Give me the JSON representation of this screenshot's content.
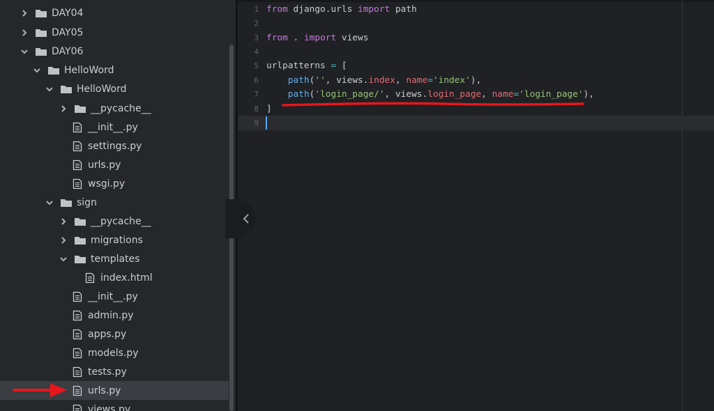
{
  "sidebar": {
    "items": [
      {
        "label": "DAY04",
        "kind": "folder",
        "chevron": "right"
      },
      {
        "label": "DAY05",
        "kind": "folder",
        "chevron": "right"
      },
      {
        "label": "DAY06",
        "kind": "folder",
        "chevron": "down"
      },
      {
        "label": "HelloWord",
        "kind": "folder",
        "chevron": "down"
      },
      {
        "label": "HelloWord",
        "kind": "folder",
        "chevron": "down"
      },
      {
        "label": "__pycache__",
        "kind": "folder",
        "chevron": "right"
      },
      {
        "label": "__init__.py",
        "kind": "file"
      },
      {
        "label": "settings.py",
        "kind": "file"
      },
      {
        "label": "urls.py",
        "kind": "file"
      },
      {
        "label": "wsgi.py",
        "kind": "file"
      },
      {
        "label": "sign",
        "kind": "folder",
        "chevron": "down"
      },
      {
        "label": "__pycache__",
        "kind": "folder",
        "chevron": "right"
      },
      {
        "label": "migrations",
        "kind": "folder",
        "chevron": "right"
      },
      {
        "label": "templates",
        "kind": "folder",
        "chevron": "down"
      },
      {
        "label": "index.html",
        "kind": "file"
      },
      {
        "label": "__init__.py",
        "kind": "file"
      },
      {
        "label": "admin.py",
        "kind": "file"
      },
      {
        "label": "apps.py",
        "kind": "file"
      },
      {
        "label": "models.py",
        "kind": "file"
      },
      {
        "label": "tests.py",
        "kind": "file"
      },
      {
        "label": "urls.py",
        "kind": "file",
        "selected": true
      },
      {
        "label": "views.py",
        "kind": "file"
      }
    ]
  },
  "editor": {
    "line_numbers": [
      "1",
      "2",
      "3",
      "4",
      "5",
      "6",
      "7",
      "8",
      "9"
    ],
    "line1": {
      "t1": "from",
      "t2": " django.urls ",
      "t3": "import",
      "t4": " path"
    },
    "line3": {
      "t1": "from",
      "t2": " . ",
      "t3": "import",
      "t4": " views"
    },
    "line5": {
      "t1": "urlpatterns ",
      "t2": "=",
      "t3": " ["
    },
    "line6": {
      "t1": "    ",
      "t2": "path",
      "t3": "(",
      "t4": "''",
      "t5": ", views.",
      "t6": "index",
      "t7": ", ",
      "t8": "name",
      "t9": "=",
      "t10": "'index'",
      "t11": "),"
    },
    "line7": {
      "t1": "    ",
      "t2": "path",
      "t3": "(",
      "t4": "'login_page/'",
      "t5": ", views.",
      "t6": "login_page",
      "t7": ", ",
      "t8": "name",
      "t9": "=",
      "t10": "'login_page'",
      "t11": "),"
    },
    "line8": {
      "t1": "]"
    }
  },
  "colors": {
    "annotation_red": "#e8161b",
    "keyword": "#c678dd",
    "string": "#98c379",
    "attribute": "#e06c75",
    "function": "#61afef"
  },
  "icons": {
    "folder": "folder-icon",
    "file": "file-icon",
    "collapse": "chevron-left-icon"
  }
}
